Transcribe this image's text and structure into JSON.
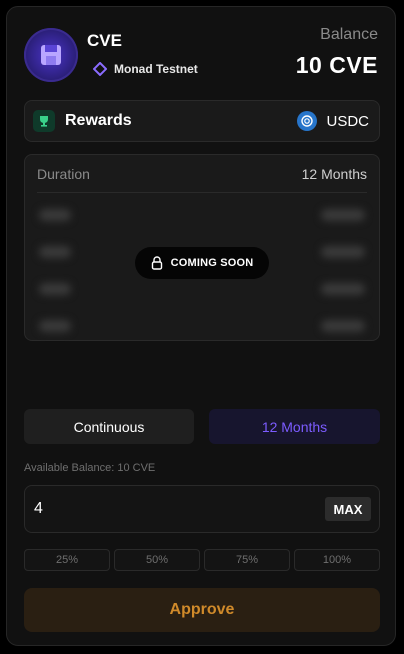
{
  "token": {
    "symbol": "CVE",
    "icon": "floppy-disk-icon",
    "network": "Monad Testnet",
    "network_icon": "monad-diamond-icon"
  },
  "balance": {
    "label": "Balance",
    "value": "10 CVE"
  },
  "rewards": {
    "label": "Rewards",
    "icon": "trophy-icon",
    "asset": "USDC",
    "asset_icon": "usdc-icon"
  },
  "table": {
    "header_left": "Duration",
    "header_right": "12 Months",
    "overlay_label": "COMING SOON",
    "overlay_icon": "lock-icon"
  },
  "segments": [
    {
      "label": "Continuous",
      "selected": false
    },
    {
      "label": "12 Months",
      "selected": true
    }
  ],
  "available": "Available Balance: 10 CVE",
  "amount": {
    "value": "4",
    "max_label": "MAX"
  },
  "percent_buttons": [
    "25%",
    "50%",
    "75%",
    "100%"
  ],
  "approve_label": "Approve",
  "colors": {
    "accent_purple": "#7c5cff",
    "approve_text": "#d08a2a",
    "usdc_blue": "#2775ca"
  }
}
